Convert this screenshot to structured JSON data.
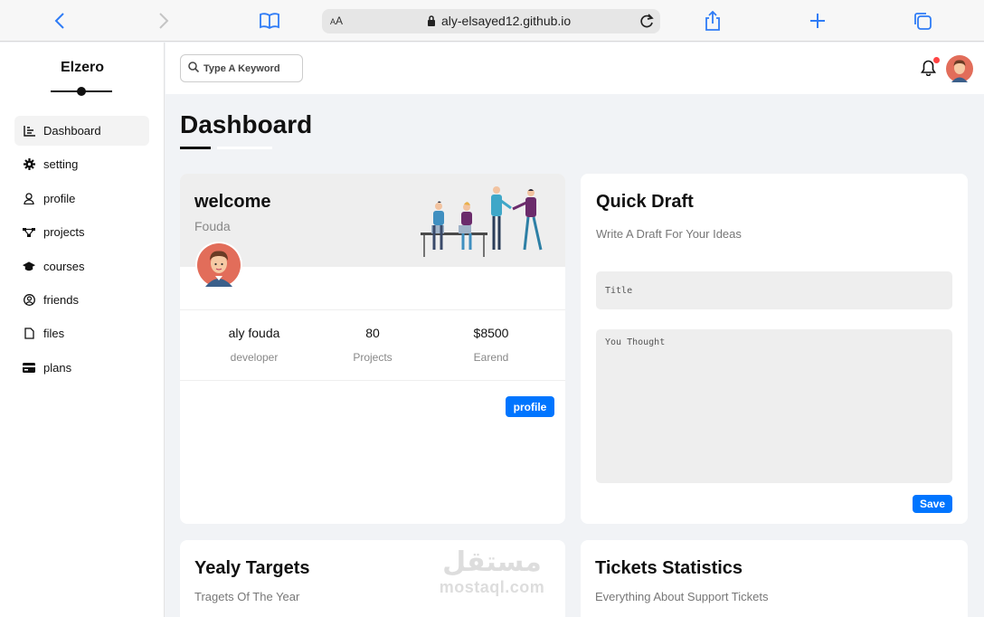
{
  "browser": {
    "text_size_small": "A",
    "text_size_large": "A",
    "url": "aly-elsayed12.github.io"
  },
  "sidebar": {
    "brand": "Elzero",
    "items": [
      {
        "label": "Dashboard",
        "icon": "chart-icon",
        "active": true
      },
      {
        "label": "setting",
        "icon": "gear-icon"
      },
      {
        "label": "profile",
        "icon": "user-icon"
      },
      {
        "label": "projects",
        "icon": "diagram-icon"
      },
      {
        "label": "courses",
        "icon": "graduation-cap-icon"
      },
      {
        "label": "friends",
        "icon": "user-circle-icon"
      },
      {
        "label": "files",
        "icon": "file-icon"
      },
      {
        "label": "plans",
        "icon": "credit-card-icon"
      }
    ]
  },
  "header": {
    "search_placeholder": "Type A Keyword"
  },
  "page": {
    "title": "Dashboard"
  },
  "welcome": {
    "title": "welcome",
    "name": "Fouda",
    "stats": [
      {
        "value": "aly fouda",
        "label": "developer"
      },
      {
        "value": "80",
        "label": "Projects"
      },
      {
        "value": "$8500",
        "label": "Earend"
      }
    ],
    "button": "profile"
  },
  "draft": {
    "title": "Quick Draft",
    "subtitle": "Write A Draft For Your Ideas",
    "title_placeholder": "Title",
    "text_placeholder": "You Thought",
    "button": "Save"
  },
  "targets": {
    "title": "Yealy Targets",
    "subtitle": "Tragets Of The Year"
  },
  "tickets": {
    "title": "Tickets Statistics",
    "subtitle": "Everything About Support Tickets"
  },
  "watermark": {
    "arabic": "مستقل",
    "latin": "mostaql.com"
  },
  "colors": {
    "accent": "#0075ff",
    "page_bg": "#f1f3f6",
    "browser_accent": "#2f7cf6"
  }
}
